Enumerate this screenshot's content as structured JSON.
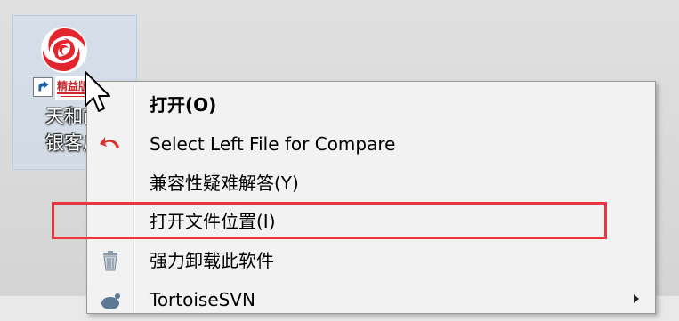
{
  "desktop": {
    "icon": {
      "caption_lines": [
        "天和商",
        "银客户"
      ],
      "badge": "精益版",
      "logo_icon": "red-swirl-logo-icon",
      "shortcut_icon": "shortcut-arrow-icon"
    }
  },
  "context_menu": {
    "items": [
      {
        "label": "打开(O)",
        "bold": true,
        "icon": null
      },
      {
        "label": "Select Left File for Compare",
        "icon": "red-undo-arrow-icon"
      },
      {
        "label": "兼容性疑难解答(Y)",
        "icon": null
      },
      {
        "label": "打开文件位置(I)",
        "icon": null,
        "highlighted": true
      },
      {
        "label": "强力卸载此软件",
        "icon": "trash-can-icon"
      },
      {
        "label": "TortoiseSVN",
        "icon": "tortoise-icon",
        "has_submenu": true
      }
    ]
  },
  "colors": {
    "highlight": "#e8373f",
    "menu_bg": "#f2f2f2",
    "logo_red": "#e3262e"
  }
}
